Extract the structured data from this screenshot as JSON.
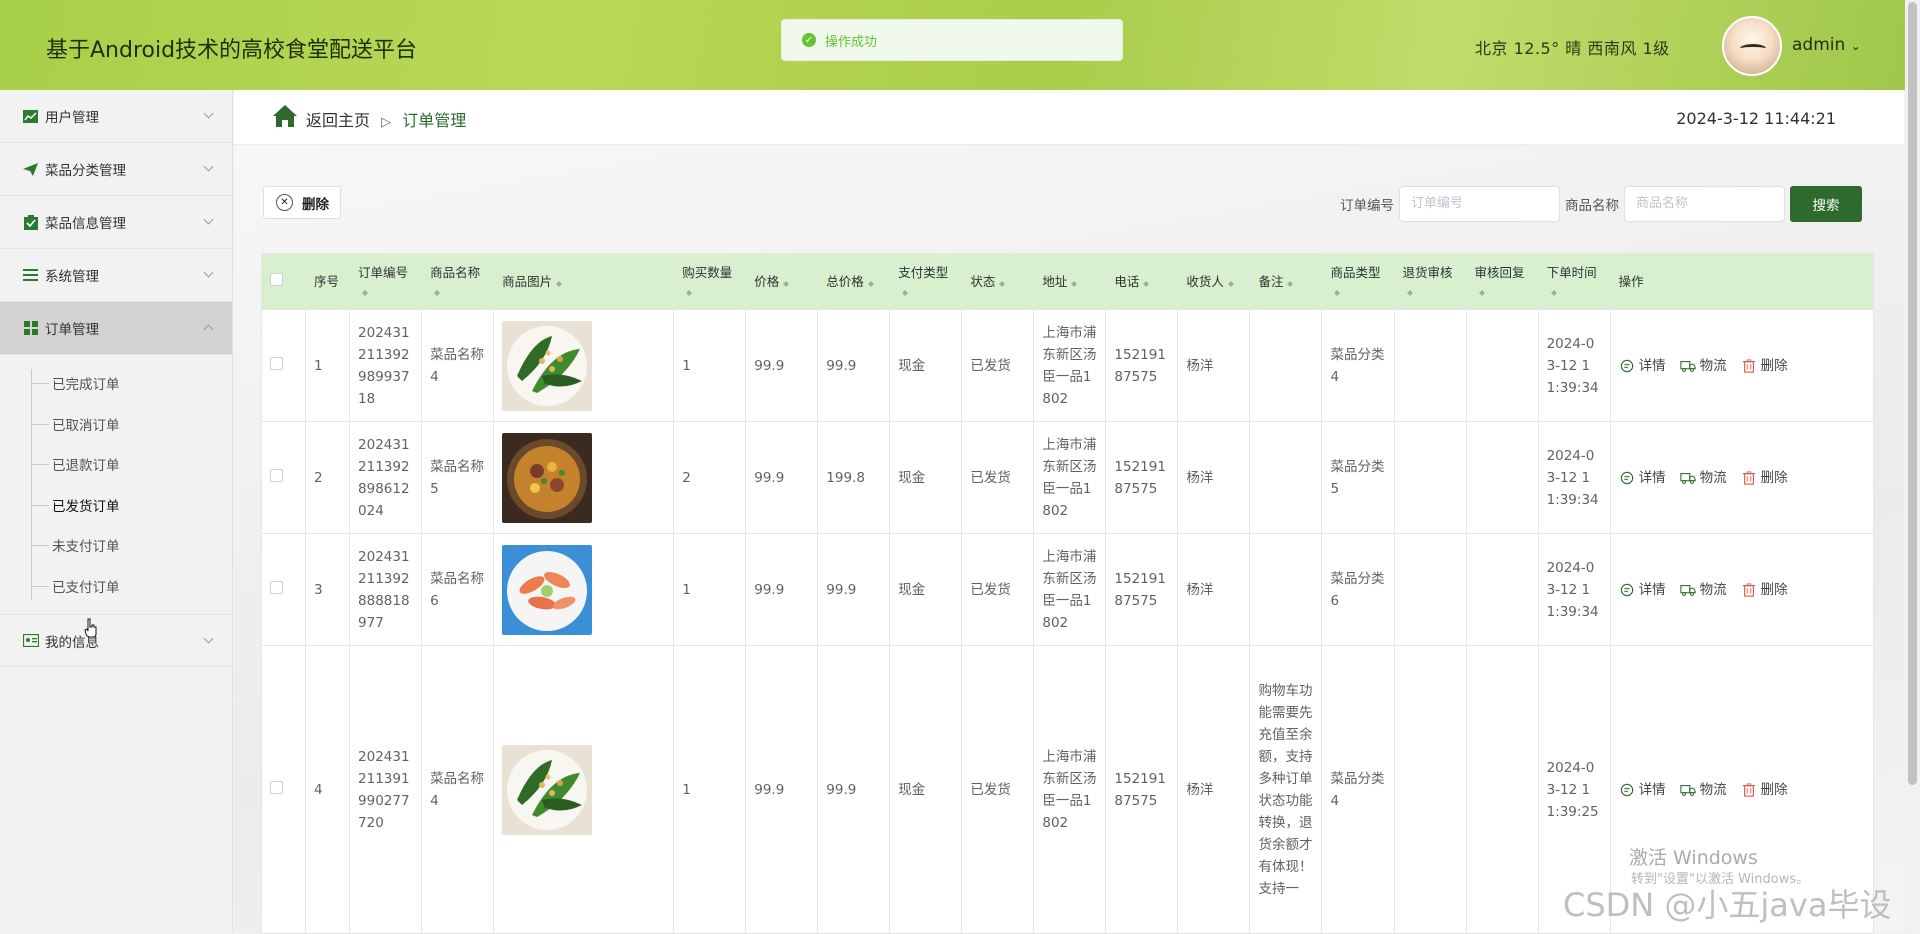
{
  "app": {
    "title": "基于Android技术的高校食堂配送平台",
    "toast": "操作成功",
    "weather": "北京  12.5°  晴  西南风  1级",
    "user": "admin"
  },
  "sidebar": {
    "items": [
      {
        "label": "用户管理",
        "icon": "chart-icon"
      },
      {
        "label": "菜品分类管理",
        "icon": "send-icon"
      },
      {
        "label": "菜品信息管理",
        "icon": "clipboard-check-icon"
      },
      {
        "label": "系统管理",
        "icon": "list-icon"
      },
      {
        "label": "订单管理",
        "icon": "grid-icon"
      },
      {
        "label": "我的信息",
        "icon": "id-card-icon"
      }
    ],
    "submenu": [
      "已完成订单",
      "已取消订单",
      "已退款订单",
      "已发货订单",
      "未支付订单",
      "已支付订单"
    ]
  },
  "breadcrumb": {
    "home": "返回主页",
    "separator": "▷",
    "current": "订单管理"
  },
  "datetime": "2024-3-12 11:44:21",
  "toolbar": {
    "delete_label": "删除",
    "order_no_label": "订单编号",
    "order_no_placeholder": "订单编号",
    "goods_name_label": "商品名称",
    "goods_name_placeholder": "商品名称",
    "search_label": "搜索"
  },
  "table": {
    "headers": [
      "序号",
      "订单编号",
      "商品名称",
      "商品图片",
      "购买数量",
      "价格",
      "总价格",
      "支付类型",
      "状态",
      "地址",
      "电话",
      "收货人",
      "备注",
      "商品类型",
      "退货审核",
      "审核回复",
      "下单时间",
      "操作"
    ],
    "rows": [
      {
        "idx": "1",
        "order_no": "202431211392989937 18",
        "name": "菜品名称4",
        "qty": "1",
        "price": "99.9",
        "total": "99.9",
        "pay": "现金",
        "status": "已发货",
        "addr": "上海市浦东新区汤臣一品1802",
        "phone": "15219187575",
        "receiver": "杨洋",
        "remark": "",
        "type": "菜品分类4",
        "refund": "",
        "reply": "",
        "time": "2024-03-12 11:39:34",
        "img": "greens"
      },
      {
        "idx": "2",
        "order_no": "202431211392898612 024",
        "name": "菜品名称5",
        "qty": "2",
        "price": "99.9",
        "total": "199.8",
        "pay": "现金",
        "status": "已发货",
        "addr": "上海市浦东新区汤臣一品1802",
        "phone": "15219187575",
        "receiver": "杨洋",
        "remark": "",
        "type": "菜品分类5",
        "refund": "",
        "reply": "",
        "time": "2024-03-12 11:39:34",
        "img": "stew"
      },
      {
        "idx": "3",
        "order_no": "202431211392888818 977",
        "name": "菜品名称6",
        "qty": "1",
        "price": "99.9",
        "total": "99.9",
        "pay": "现金",
        "status": "已发货",
        "addr": "上海市浦东新区汤臣一品1802",
        "phone": "15219187575",
        "receiver": "杨洋",
        "remark": "",
        "type": "菜品分类6",
        "refund": "",
        "reply": "",
        "time": "2024-03-12 11:39:34",
        "img": "shrimp"
      },
      {
        "idx": "4",
        "order_no": "202431211391990277 720",
        "name": "菜品名称4",
        "qty": "1",
        "price": "99.9",
        "total": "99.9",
        "pay": "现金",
        "status": "已发货",
        "addr": "上海市浦东新区汤臣一品1802",
        "phone": "15219187575",
        "receiver": "杨洋",
        "remark": "购物车功能需要先充值至余额，支持多种订单状态功能转换，退货余额才有体现！支持一",
        "type": "菜品分类4",
        "refund": "",
        "reply": "",
        "time": "2024-03-12 11:39:25",
        "img": "greens"
      }
    ],
    "ops": {
      "detail": "详情",
      "logistics": "物流",
      "delete": "删除"
    }
  },
  "overlay": {
    "activate_windows": "激活 Windows",
    "activate_hint": "转到\"设置\"以激活 Windows。",
    "csdn": "CSDN @小五java毕设"
  },
  "colors": {
    "accent": "#2d6a2e",
    "header": "#a8cf4a",
    "table_header": "#d7f1cf"
  }
}
